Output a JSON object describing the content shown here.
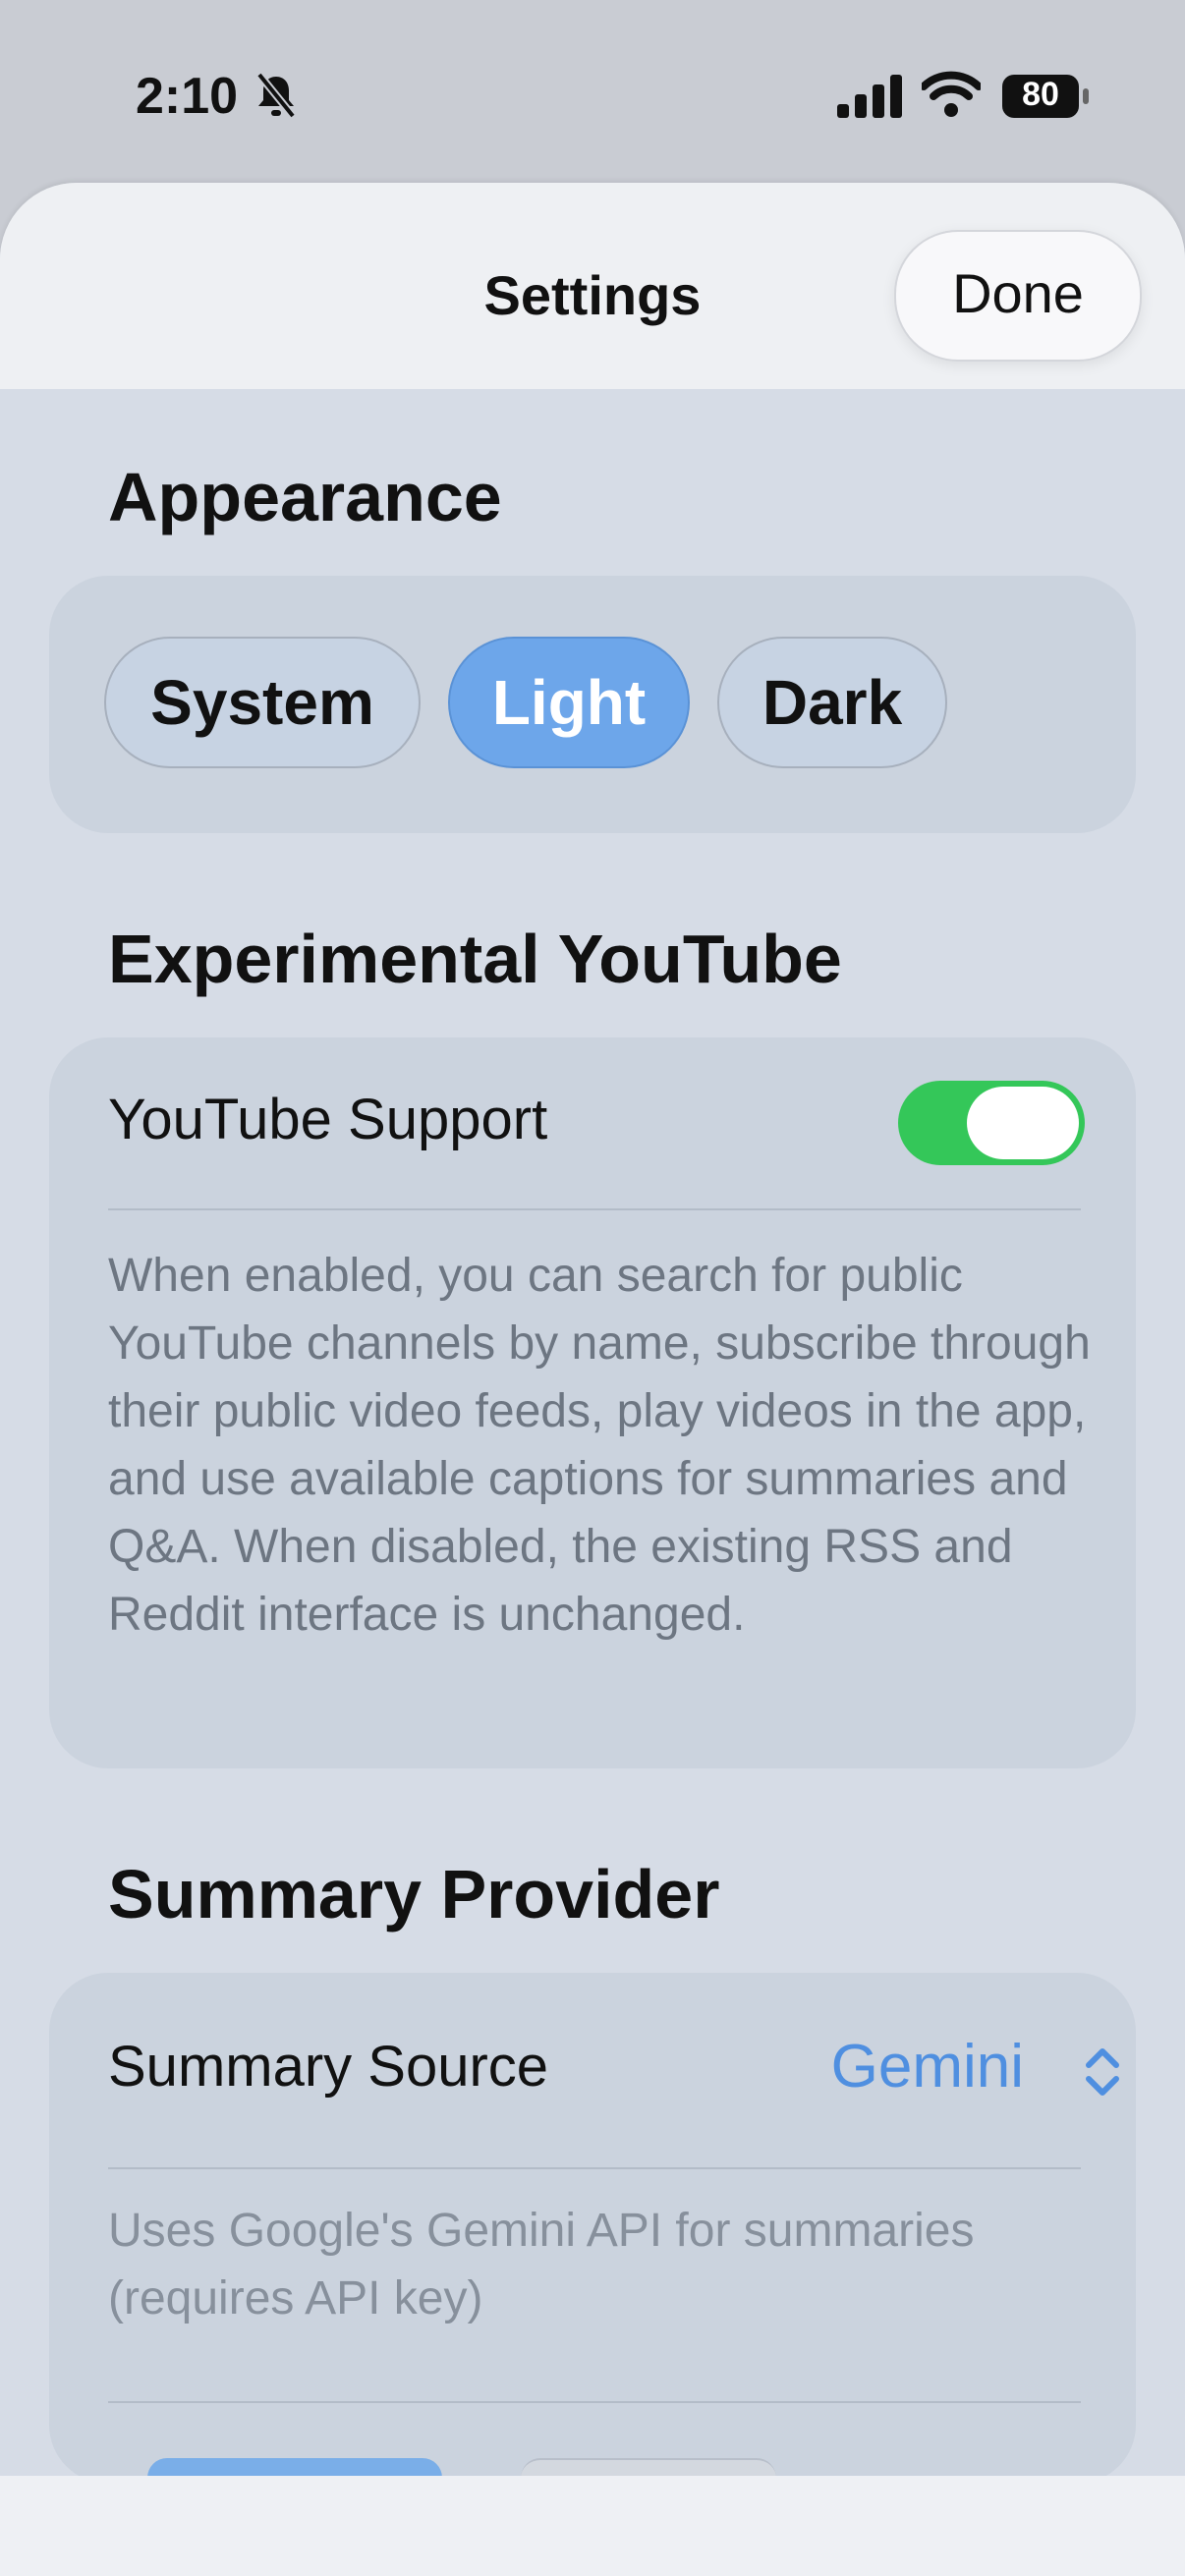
{
  "status_bar": {
    "time": "2:10",
    "battery": "80",
    "icons": [
      "bell-slash-icon",
      "signal-icon",
      "wifi-icon",
      "battery-icon"
    ]
  },
  "nav": {
    "title": "Settings",
    "done_label": "Done"
  },
  "appearance": {
    "title": "Appearance",
    "options": [
      "System",
      "Light",
      "Dark"
    ],
    "selected": "Light"
  },
  "youtube": {
    "title": "Experimental YouTube",
    "toggle_label": "YouTube Support",
    "toggle_on": true,
    "description": "When enabled, you can search for public YouTube channels by name, subscribe through their public video feeds, play videos in the app, and use available captions for summaries and Q&A. When disabled, the existing RSS and Reddit interface is unchanged."
  },
  "summary": {
    "title": "Summary Provider",
    "source_label": "Summary Source",
    "source_value": "Gemini",
    "description": "Uses Google's Gemini API for summaries (requires API key)"
  },
  "colors": {
    "accent": "#4f8fe0",
    "toggle_on": "#34c759",
    "selected_segment": "#6da6ea"
  }
}
